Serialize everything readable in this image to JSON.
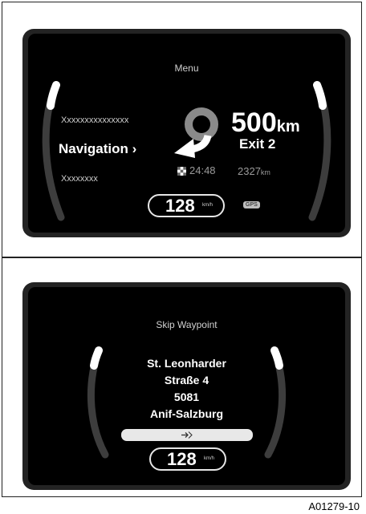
{
  "nav_screen": {
    "menu_title": "Menu",
    "menu_above": "Xxxxxxxxxxxxxxx",
    "menu_selected": "Navigation",
    "menu_selected_chevron": "›",
    "menu_below": "Xxxxxxxx",
    "distance_value": "500",
    "distance_unit": "km",
    "maneuver": "Exit 2",
    "maneuver_icon": "roundabout-exit-arrow-icon",
    "flag_icon": "checkered-flag-icon",
    "arrival_time": "24:48",
    "remaining_distance": "2327",
    "remaining_unit": "km",
    "speed": "128",
    "speed_unit": "km/h",
    "gps_badge": "GPS"
  },
  "waypoint_screen": {
    "title": "Skip Waypoint",
    "address_line1": "St. Leonharder",
    "address_line2": "Straße 4",
    "address_line3": "5081",
    "address_line4": "Anif-Salzburg",
    "skip_icon": "skip-waypoint-icon",
    "speed": "128",
    "speed_unit": "km/h"
  },
  "figure_ref": "A01279-10"
}
